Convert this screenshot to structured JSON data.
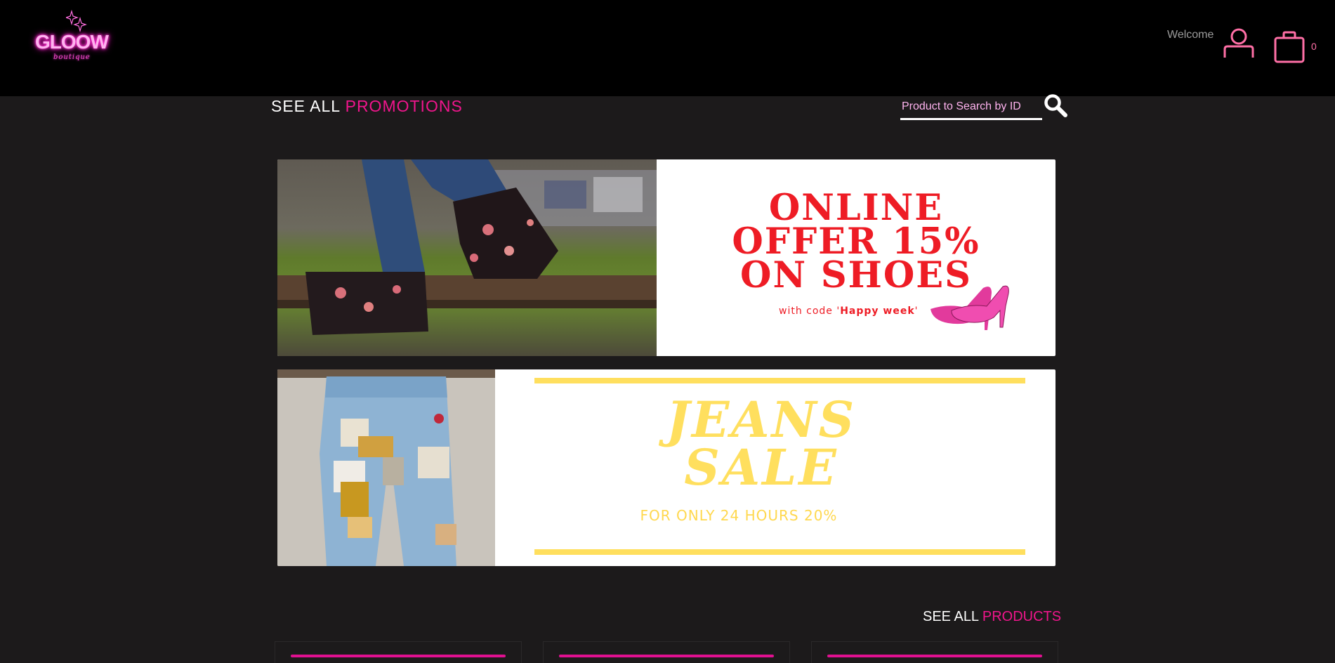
{
  "header": {
    "logo_text": "GLOOW",
    "logo_subtext": "boutique",
    "welcome_text": "Welcome",
    "cart_count": "0"
  },
  "promotions": {
    "see_all": "SEE ALL",
    "title_highlight": "PROMOTIONS",
    "search_placeholder": "Product to Search by ID"
  },
  "banners": [
    {
      "line1": "ONLINE",
      "line2": "OFFER 15%",
      "line3": "ON SHOES",
      "code_prefix": "with code '",
      "code_value": "Happy week",
      "code_suffix": "'"
    },
    {
      "line1": "JEANS",
      "line2": "SALE",
      "subtitle": "FOR ONLY 24 HOURS 20%"
    }
  ],
  "products": {
    "see_all": "SEE ALL",
    "title_highlight": "PRODUCTS"
  },
  "colors": {
    "accent_pink": "#f0158c",
    "background": "#1c1a1b",
    "header_bg": "#000000",
    "promo_red": "#ee1c25",
    "promo_yellow": "#ffdf5e"
  },
  "icons": [
    "sparkle-icon",
    "user-icon",
    "shopping-bag-icon",
    "search-icon",
    "high-heels-icon"
  ]
}
